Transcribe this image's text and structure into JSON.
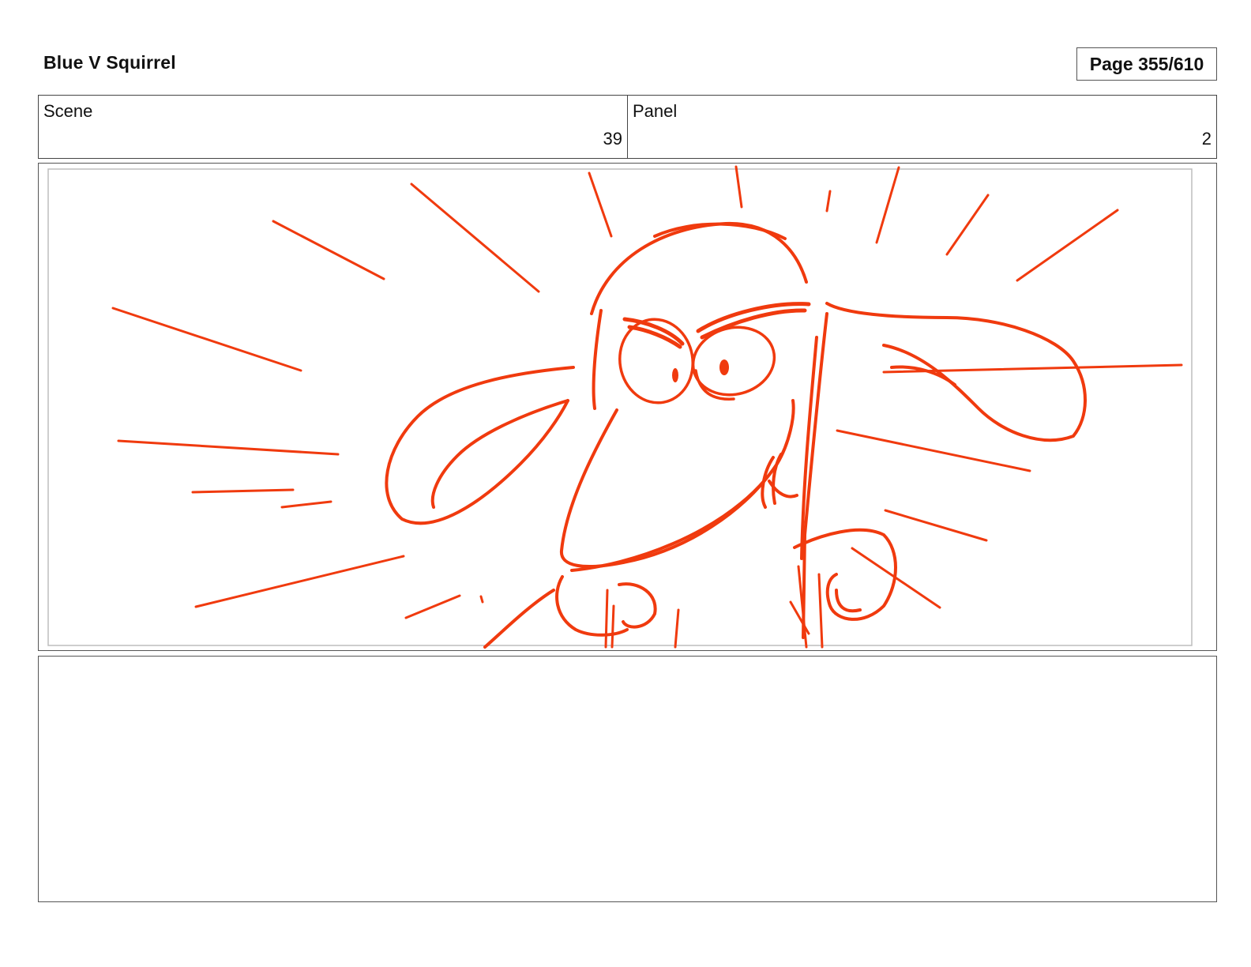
{
  "header": {
    "project_title": "Blue V Squirrel",
    "page_label": "Page 355/610"
  },
  "info": {
    "scene_label": "Scene",
    "scene_number": "39",
    "panel_label": "Panel",
    "panel_number": "2"
  },
  "drawing": {
    "subject": "angry-squirrel-sketch",
    "stroke_color": "#f03a0e"
  },
  "notes": {
    "text": ""
  }
}
